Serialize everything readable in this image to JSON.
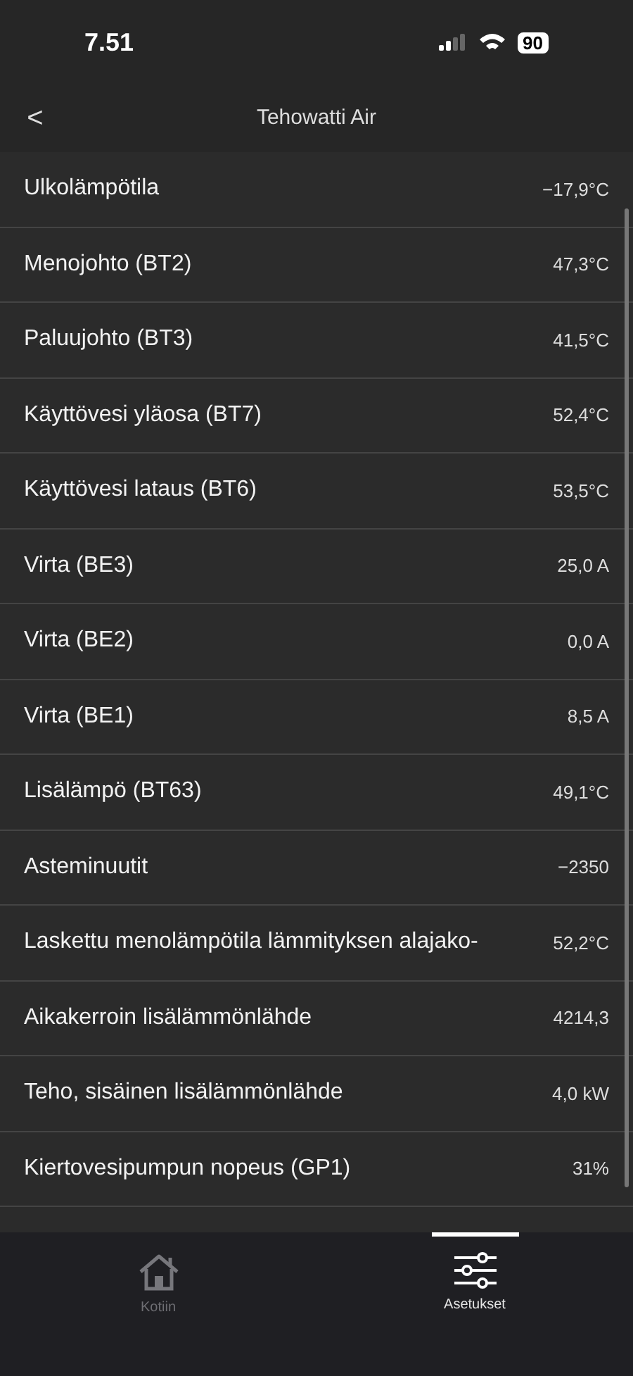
{
  "status_bar": {
    "time": "7.51",
    "battery": "90"
  },
  "header": {
    "back": "<",
    "title": "Tehowatti Air"
  },
  "rows": [
    {
      "label": "Ulkolämpötila",
      "value": "−17,9°C"
    },
    {
      "label": "Menojohto (BT2)",
      "value": "47,3°C"
    },
    {
      "label": "Paluujohto (BT3)",
      "value": "41,5°C"
    },
    {
      "label": "Käyttövesi yläosa (BT7)",
      "value": "52,4°C"
    },
    {
      "label": "Käyttövesi lataus (BT6)",
      "value": "53,5°C"
    },
    {
      "label": "Virta (BE3)",
      "value": "25,0 A"
    },
    {
      "label": "Virta (BE2)",
      "value": "0,0 A"
    },
    {
      "label": "Virta (BE1)",
      "value": "8,5 A"
    },
    {
      "label": "Lisälämpö (BT63)",
      "value": "49,1°C"
    },
    {
      "label": "Asteminuutit",
      "value": "−2350"
    },
    {
      "label": "Laskettu menolämpötila lämmityksen alajako-",
      "value": "52,2°C"
    },
    {
      "label": "Aikakerroin lisälämmönlähde",
      "value": "4214,3"
    },
    {
      "label": "Teho, sisäinen lisälämmönlähde",
      "value": "4,0 kW"
    },
    {
      "label": "Kiertovesipumpun nopeus (GP1)",
      "value": "31%"
    }
  ],
  "tabs": [
    {
      "kind": "home",
      "label": "Kotiin",
      "selected": false
    },
    {
      "kind": "settings",
      "label": "Asetukset",
      "selected": true
    }
  ]
}
